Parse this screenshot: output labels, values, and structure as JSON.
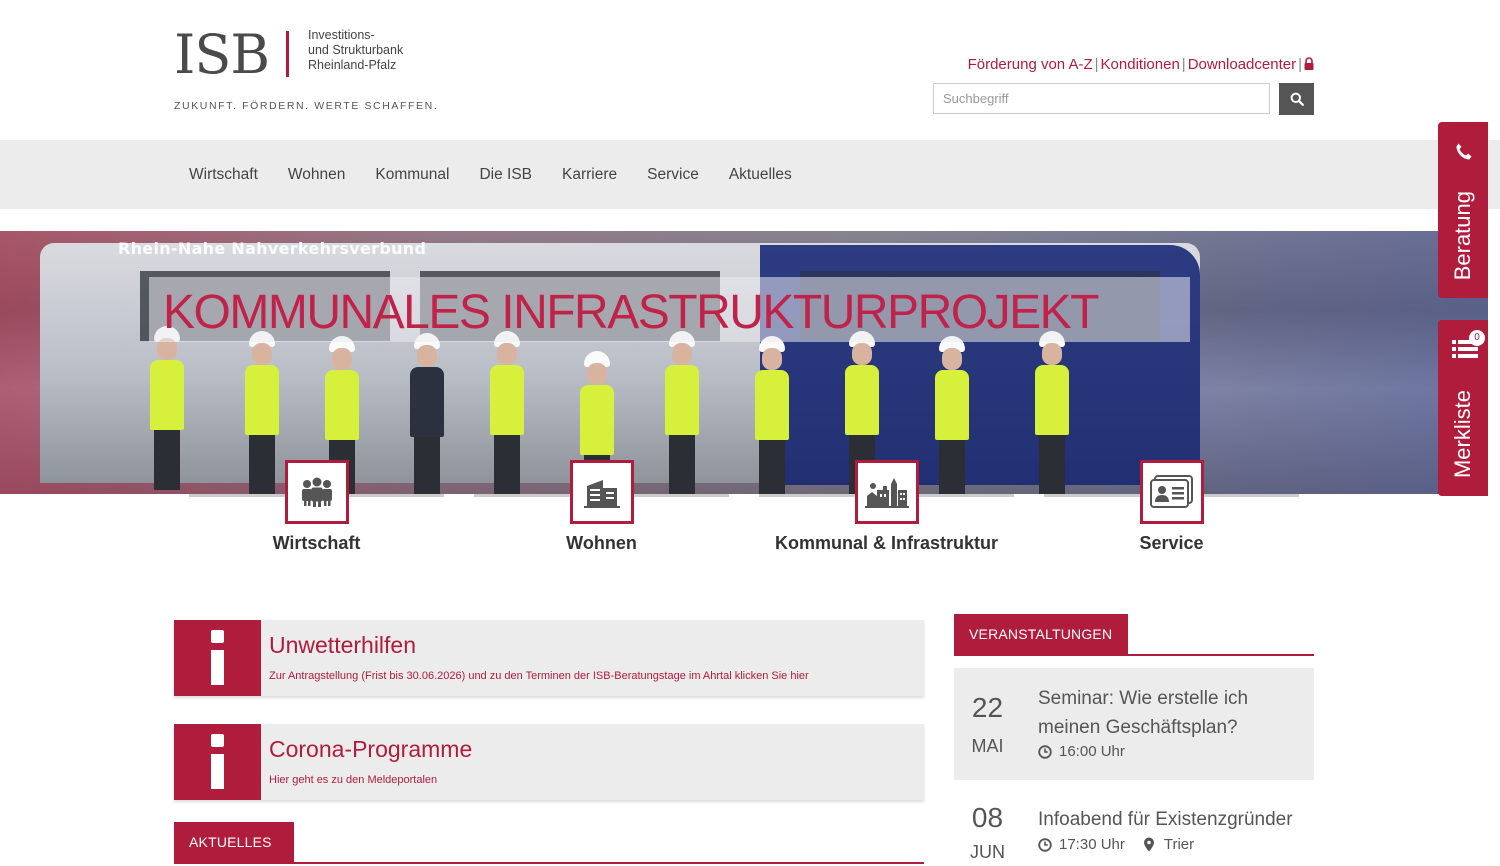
{
  "header": {
    "logo_text": "ISB",
    "logo_lines": [
      "Investitions-",
      "und Strukturbank",
      "Rheinland-Pfalz"
    ],
    "slogan": "ZUKUNFT. FÖRDERN. WERTE SCHAFFEN.",
    "top_links": [
      "Förderung von A-Z",
      "Konditionen",
      "Downloadcenter"
    ],
    "search_placeholder": "Suchbegriff"
  },
  "nav": {
    "items": [
      "Wirtschaft",
      "Wohnen",
      "Kommunal",
      "Die ISB",
      "Karriere",
      "Service",
      "Aktuelles"
    ]
  },
  "hero": {
    "bus_label": "Rhein-Nahe Nahverkehrsverbund",
    "caption": "KOMMUNALES INFRASTRUKTURPROJEKT"
  },
  "categories": [
    {
      "label": "Wirtschaft",
      "icon": "people-group-icon"
    },
    {
      "label": "Wohnen",
      "icon": "buildings-icon"
    },
    {
      "label": "Kommunal & Infrastruktur",
      "icon": "town-icon"
    },
    {
      "label": "Service",
      "icon": "contact-card-icon"
    }
  ],
  "info_boxes": [
    {
      "title": "Unwetterhilfen",
      "text": "Zur Antragstellung (Frist bis 30.06.2026) und zu den Terminen der ISB-Beratungstage im Ahrtal klicken Sie hier"
    },
    {
      "title": "Corona-Programme",
      "text": "Hier geht es zu den Meldeportalen"
    }
  ],
  "aktuelles": {
    "label": "AKTUELLES"
  },
  "events": {
    "label": "VERANSTALTUNGEN",
    "items": [
      {
        "day": "22",
        "month": "MAI",
        "title": "Seminar: Wie erstelle ich meinen Geschäftsplan?",
        "time": "16:00 Uhr",
        "location": ""
      },
      {
        "day": "08",
        "month": "JUN",
        "title": "Infoabend für Existenzgründer",
        "time": "17:30 Uhr",
        "location": "Trier"
      }
    ]
  },
  "side_tabs": {
    "beratung": "Beratung",
    "merkliste": "Merkliste",
    "merkliste_count": "0"
  },
  "colors": {
    "accent": "#b01c3c",
    "nav_bg": "#ececec",
    "box_bg": "#ececec"
  }
}
